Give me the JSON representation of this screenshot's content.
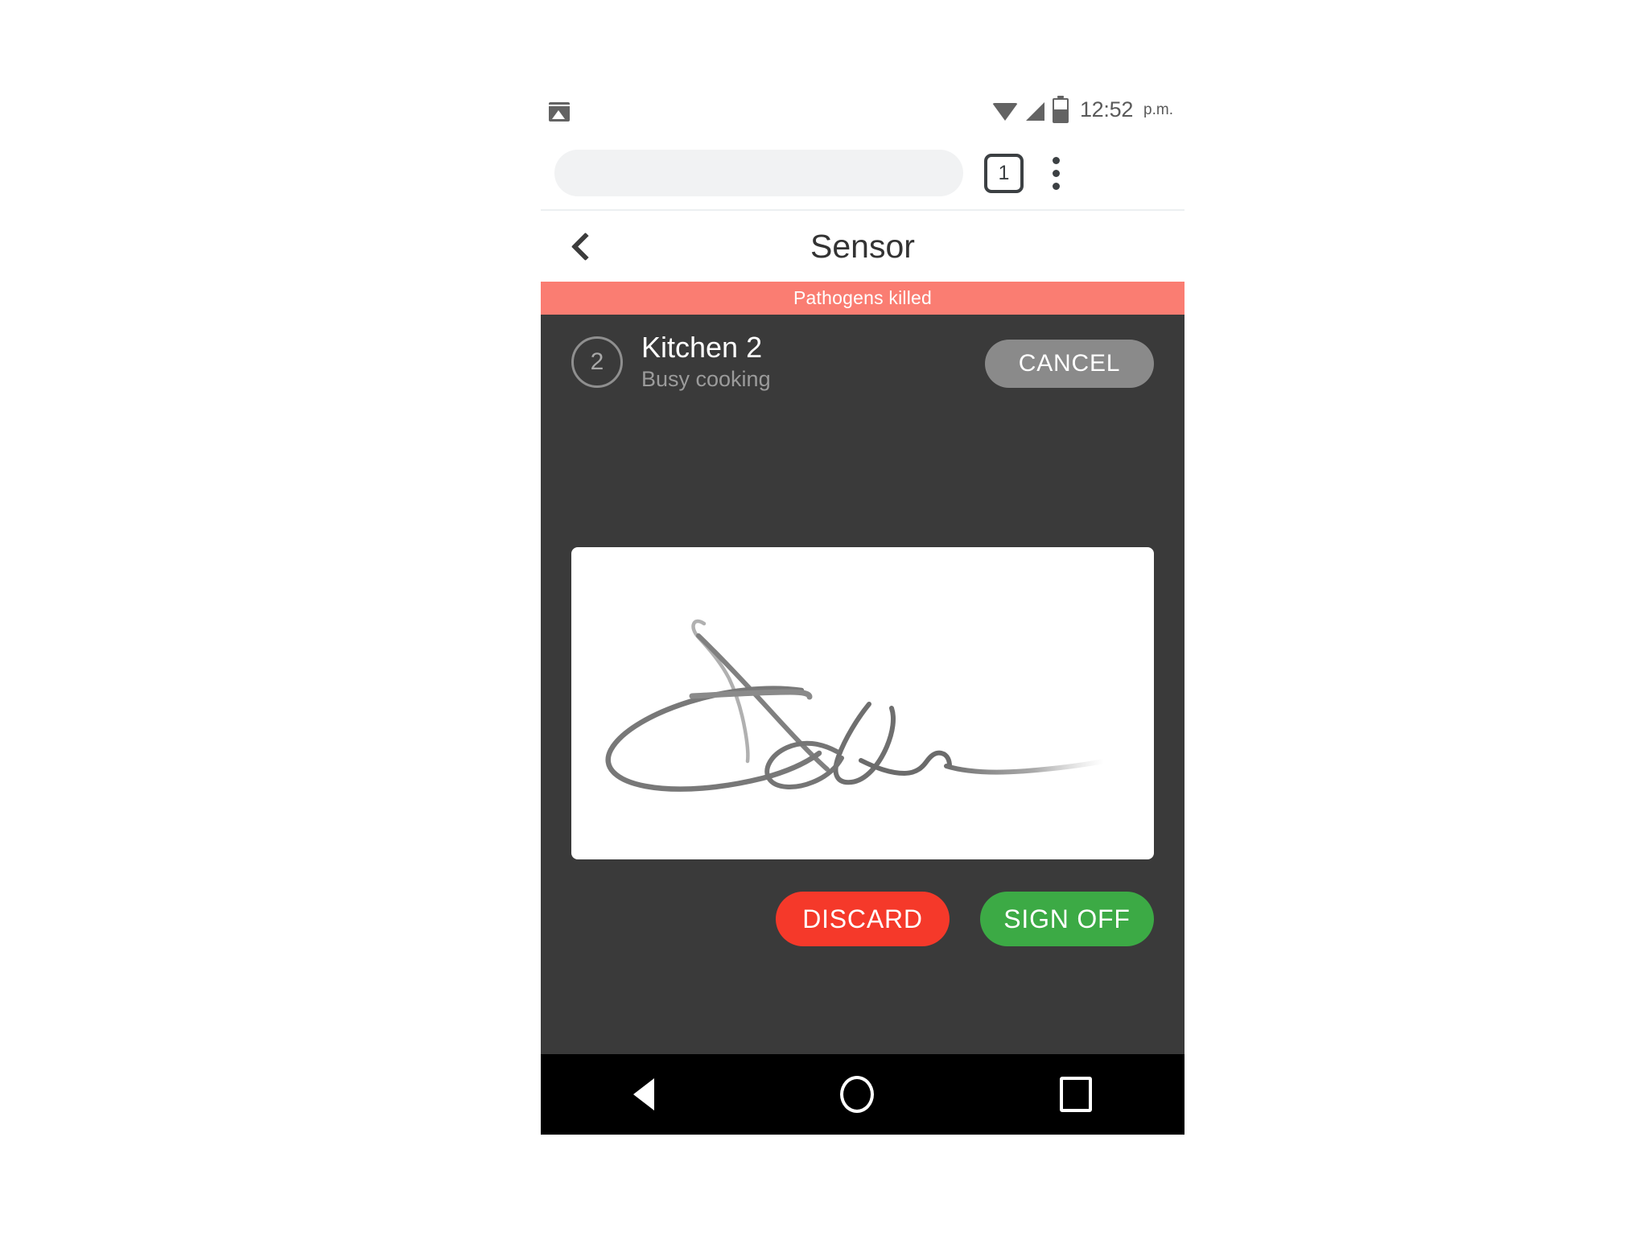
{
  "status_bar": {
    "notification_icon": "photo-icon",
    "wifi_icon": "wifi-icon",
    "signal_icon": "cellular-signal-icon",
    "battery_icon": "battery-icon",
    "time": "12:52",
    "am_pm": "p.m."
  },
  "browser": {
    "url_value": "",
    "url_placeholder": "",
    "tab_count": "1",
    "overflow_icon": "more-vertical-icon"
  },
  "app_header": {
    "back_icon": "chevron-left-icon",
    "title": "Sensor"
  },
  "alert": {
    "text": "Pathogens killed",
    "color": "#fa7d72"
  },
  "room": {
    "badge": "2",
    "name": "Kitchen 2",
    "status": "Busy cooking",
    "cancel_label": "CANCEL",
    "cancel_color": "#8a8a8a"
  },
  "signature": {
    "pad_background": "#ffffff",
    "ink_color": "#7d7d7d",
    "state": "signed"
  },
  "actions": {
    "discard_label": "DISCARD",
    "discard_color": "#f5392a",
    "signoff_label": "SIGN OFF",
    "signoff_color": "#3caa45"
  },
  "nav_bar": {
    "back_icon": "nav-back-triangle-icon",
    "home_icon": "nav-home-circle-icon",
    "recents_icon": "nav-recents-square-icon"
  },
  "theme": {
    "panel_background": "#3a3a3a",
    "page_background": "#ffffff"
  }
}
